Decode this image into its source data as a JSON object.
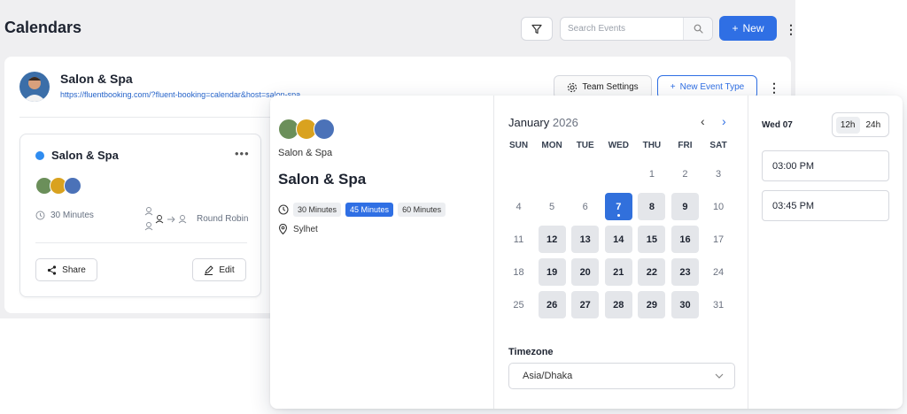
{
  "header": {
    "title": "Calendars",
    "search_placeholder": "Search Events",
    "new_label": "New"
  },
  "calendar": {
    "name": "Salon & Spa",
    "link": "https://fluentbooking.com/?fluent-booking=calendar&host=salon-spa",
    "team_settings_label": "Team Settings",
    "new_event_type_label": "New Event Type"
  },
  "event_card": {
    "title": "Salon & Spa",
    "duration": "30 Minutes",
    "assignment": "Round Robin",
    "share_label": "Share",
    "edit_label": "Edit",
    "status_color": "#2f8cf0"
  },
  "widget": {
    "host": "Salon & Spa",
    "title": "Salon & Spa",
    "durations": [
      "30 Minutes",
      "45 Minutes",
      "60 Minutes"
    ],
    "selected_duration": "45 Minutes",
    "location": "Sylhet",
    "month": "January",
    "year": "2026",
    "weekdays": [
      "SUN",
      "MON",
      "TUE",
      "WED",
      "THU",
      "FRI",
      "SAT"
    ],
    "days": [
      {
        "d": "",
        "s": "empty"
      },
      {
        "d": "",
        "s": "empty"
      },
      {
        "d": "",
        "s": "empty"
      },
      {
        "d": "",
        "s": "empty"
      },
      {
        "d": "1",
        "s": "plain"
      },
      {
        "d": "2",
        "s": "plain"
      },
      {
        "d": "3",
        "s": "plain"
      },
      {
        "d": "4",
        "s": "plain"
      },
      {
        "d": "5",
        "s": "plain"
      },
      {
        "d": "6",
        "s": "plain"
      },
      {
        "d": "7",
        "s": "selected"
      },
      {
        "d": "8",
        "s": "available"
      },
      {
        "d": "9",
        "s": "available"
      },
      {
        "d": "10",
        "s": "plain"
      },
      {
        "d": "11",
        "s": "plain"
      },
      {
        "d": "12",
        "s": "available"
      },
      {
        "d": "13",
        "s": "available"
      },
      {
        "d": "14",
        "s": "available"
      },
      {
        "d": "15",
        "s": "available"
      },
      {
        "d": "16",
        "s": "available"
      },
      {
        "d": "17",
        "s": "plain"
      },
      {
        "d": "18",
        "s": "plain"
      },
      {
        "d": "19",
        "s": "available"
      },
      {
        "d": "20",
        "s": "available"
      },
      {
        "d": "21",
        "s": "available"
      },
      {
        "d": "22",
        "s": "available"
      },
      {
        "d": "23",
        "s": "available"
      },
      {
        "d": "24",
        "s": "plain"
      },
      {
        "d": "25",
        "s": "plain"
      },
      {
        "d": "26",
        "s": "available"
      },
      {
        "d": "27",
        "s": "available"
      },
      {
        "d": "28",
        "s": "available"
      },
      {
        "d": "29",
        "s": "available"
      },
      {
        "d": "30",
        "s": "available"
      },
      {
        "d": "31",
        "s": "plain"
      }
    ],
    "timezone_label": "Timezone",
    "timezone": "Asia/Dhaka",
    "selected_date": "Wed 07",
    "time_formats": [
      "12h",
      "24h"
    ],
    "active_time_format": "12h",
    "slots": [
      "03:00 PM",
      "03:45 PM"
    ],
    "accent_color": "#2f6fe4"
  }
}
